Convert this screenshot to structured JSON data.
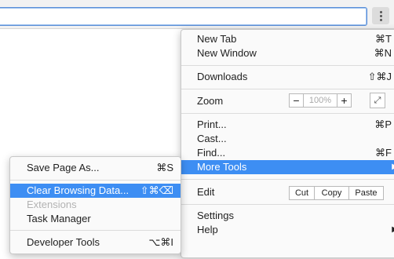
{
  "menu": {
    "new_tab": {
      "label": "New Tab",
      "shortcut": "⌘T"
    },
    "new_window": {
      "label": "New Window",
      "shortcut": "⌘N"
    },
    "downloads": {
      "label": "Downloads",
      "shortcut": "⇧⌘J"
    },
    "zoom": {
      "label": "Zoom",
      "minus": "−",
      "value": "100%",
      "plus": "+",
      "fullscreen_icon": "fullscreen-icon"
    },
    "print": {
      "label": "Print...",
      "shortcut": "⌘P"
    },
    "cast": {
      "label": "Cast..."
    },
    "find": {
      "label": "Find...",
      "shortcut": "⌘F"
    },
    "more_tools": {
      "label": "More Tools",
      "arrow": "▶"
    },
    "edit": {
      "label": "Edit",
      "cut": "Cut",
      "copy": "Copy",
      "paste": "Paste"
    },
    "settings": {
      "label": "Settings"
    },
    "help": {
      "label": "Help",
      "arrow": "▶"
    }
  },
  "submenu": {
    "save_page": {
      "label": "Save Page As...",
      "shortcut": "⌘S"
    },
    "clear_browsing": {
      "label": "Clear Browsing Data...",
      "shortcut": "⇧⌘⌫"
    },
    "extensions": {
      "label": "Extensions"
    },
    "task_manager": {
      "label": "Task Manager"
    },
    "developer_tools": {
      "label": "Developer Tools",
      "shortcut": "⌥⌘I"
    }
  },
  "colors": {
    "highlight": "#3d8ef3",
    "accent_border": "#5b8fd8"
  }
}
